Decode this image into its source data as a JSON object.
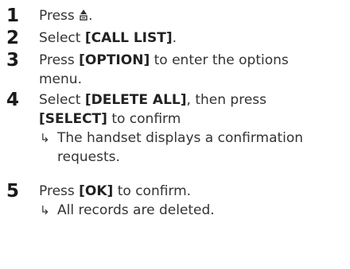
{
  "steps": [
    {
      "number": "1",
      "prefix": "Press ",
      "suffix": "."
    },
    {
      "number": "2",
      "prefix": "Select ",
      "key": "[CALL LIST]",
      "suffix": "."
    },
    {
      "number": "3",
      "prefix": "Press ",
      "key": "[OPTION]",
      "suffix": " to enter the options",
      "line2": "menu."
    },
    {
      "number": "4",
      "prefix": "Select ",
      "key": "[DELETE ALL]",
      "suffix": ", then press",
      "key2": "[SELECT]",
      "suffix2": " to confirm",
      "result_line1": "The handset displays a confirmation",
      "result_line2": "requests."
    },
    {
      "number": "5",
      "prefix": "Press ",
      "key": "[OK]",
      "suffix": " to confirm.",
      "result_line1": "All records are deleted."
    }
  ],
  "icons": {
    "step1": "up-down-arrow-icon",
    "result": "right-hook-arrow-icon"
  },
  "result_arrow": "↳"
}
